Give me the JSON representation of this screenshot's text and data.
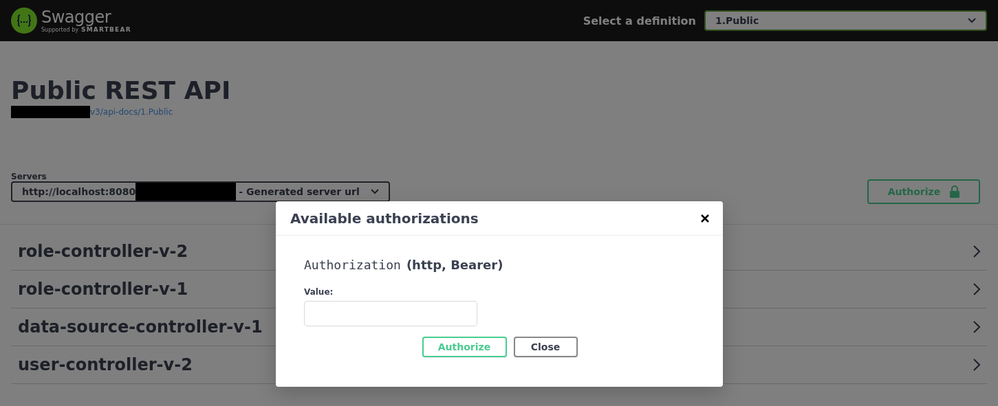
{
  "topbar": {
    "logo_text": "Swagger",
    "logo_supported": "Supported by",
    "logo_brand": "SMARTBEAR",
    "definition_label": "Select a definition",
    "definition_value": "1.Public"
  },
  "info": {
    "title": "Public REST API",
    "url": "v3/api-docs/1.Public"
  },
  "servers": {
    "label": "Servers",
    "value_start": "http://localhost:8080",
    "value_end": "- Generated server url"
  },
  "authorize_button": {
    "label": "Authorize"
  },
  "tags": [
    {
      "name": "role-controller-v-2"
    },
    {
      "name": "role-controller-v-1"
    },
    {
      "name": "data-source-controller-v-1"
    },
    {
      "name": "user-controller-v-2"
    }
  ],
  "modal": {
    "title": "Available authorizations",
    "scheme_name": "Authorization",
    "scheme_type": "(http, Bearer)",
    "value_label": "Value:",
    "buttons": [
      {
        "label": "Authorize",
        "kind": "primary"
      },
      {
        "label": "Close",
        "kind": "secondary"
      }
    ]
  }
}
